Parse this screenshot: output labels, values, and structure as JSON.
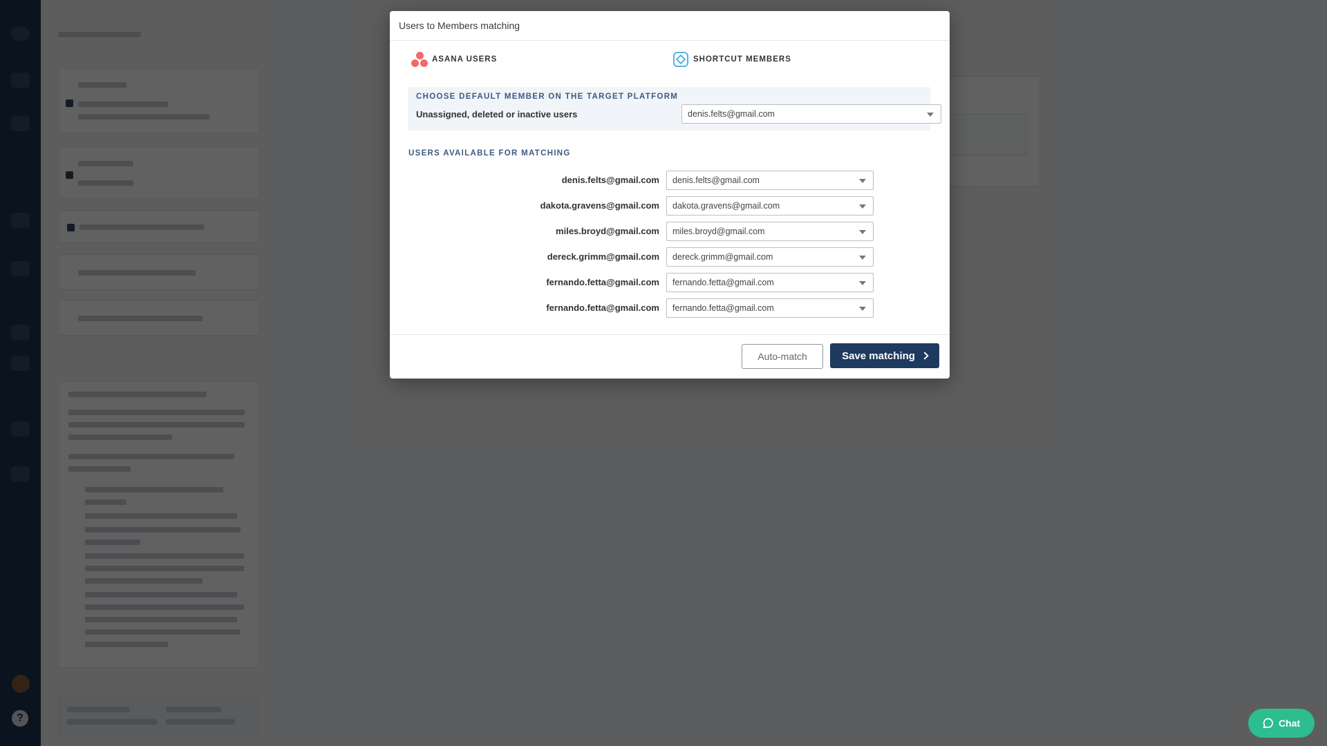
{
  "modal": {
    "title": "Users to Members matching",
    "source_platform": "ASANA USERS",
    "target_platform": "SHORTCUT MEMBERS",
    "default_section": {
      "label": "CHOOSE DEFAULT MEMBER ON THE TARGET PLATFORM",
      "row_label": "Unassigned, deleted or inactive users",
      "selected": "denis.felts@gmail.com"
    },
    "available_label": "USERS AVAILABLE FOR MATCHING",
    "matches": [
      {
        "source": "denis.felts@gmail.com",
        "target": "denis.felts@gmail.com"
      },
      {
        "source": "dakota.gravens@gmail.com",
        "target": "dakota.gravens@gmail.com"
      },
      {
        "source": "miles.broyd@gmail.com",
        "target": "miles.broyd@gmail.com"
      },
      {
        "source": "dereck.grimm@gmail.com",
        "target": "dereck.grimm@gmail.com"
      },
      {
        "source": "fernando.fetta@gmail.com",
        "target": "fernando.fetta@gmail.com"
      },
      {
        "source": "fernando.fetta@gmail.com",
        "target": "fernando.fetta@gmail.com"
      }
    ],
    "auto_match_label": "Auto-match",
    "save_label": "Save matching"
  },
  "chat": {
    "label": "Chat"
  },
  "colors": {
    "primary": "#1f3a5f",
    "accent": "#2dbd8f",
    "asana": "#f06a6a",
    "shortcut": "#58b1e4"
  }
}
